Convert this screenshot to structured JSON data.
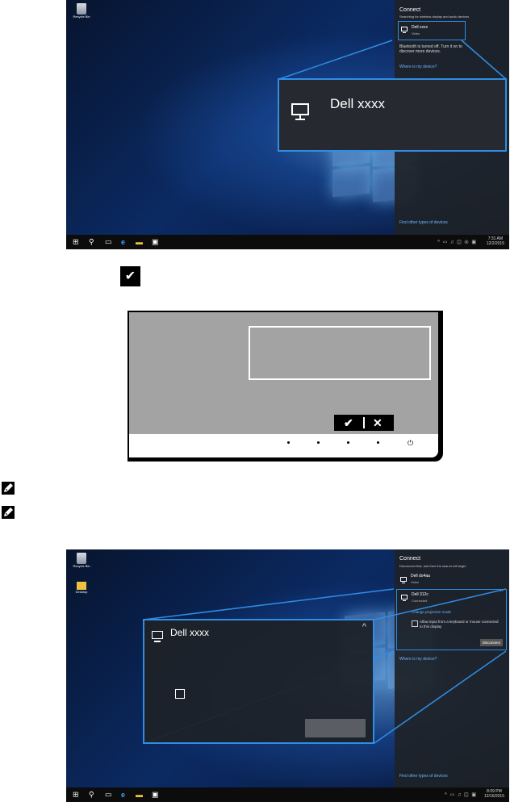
{
  "screenshot1": {
    "desktop": {
      "recycle_bin": "Recycle Bin"
    },
    "panel": {
      "title": "Connect",
      "subtitle": "Searching for wireless display and audio devices",
      "device_name": "Dell xxxx",
      "device_sub": "Video",
      "bluetooth_msg": "Bluetooth is turned off. Turn it on to discover more devices.",
      "where_link": "Where is my device?",
      "find_link": "Find other types of devices"
    },
    "zoom_device": "Dell xxxx",
    "clock": {
      "time": "7:31 AM",
      "date": "12/2/2015"
    }
  },
  "monitor": {
    "check_mark": "✔",
    "close_mark": "✕",
    "power_symbol": "⏻"
  },
  "notes": {
    "icon1": "note-pencil-icon",
    "icon2": "note-pencil-icon"
  },
  "screenshot2": {
    "desktop": {
      "recycle_bin": "Recycle Bin",
      "desktop_folder": "Desktop"
    },
    "panel": {
      "title": "Connect",
      "subtitle": "Disconnect first, and then the search will begin",
      "device1_name": "Dell do4aa",
      "device1_sub": "Video",
      "device2_name": "Dell 312c",
      "device2_sub": "Connected",
      "change_mode": "Change projection mode",
      "allow_input": "Allow input from a keyboard or mouse connected to this display",
      "disconnect_btn": "Disconnect",
      "where_link": "Where is my device?",
      "find_link": "Find other types of devices"
    },
    "zoom_device": "Dell xxxx",
    "clock": {
      "time": "8:09 PM",
      "date": "12/16/2015"
    }
  },
  "colors": {
    "accent_blue": "#2f8de4",
    "taskbar": "#0c0c0c",
    "panel_bg": "#1e2228"
  }
}
